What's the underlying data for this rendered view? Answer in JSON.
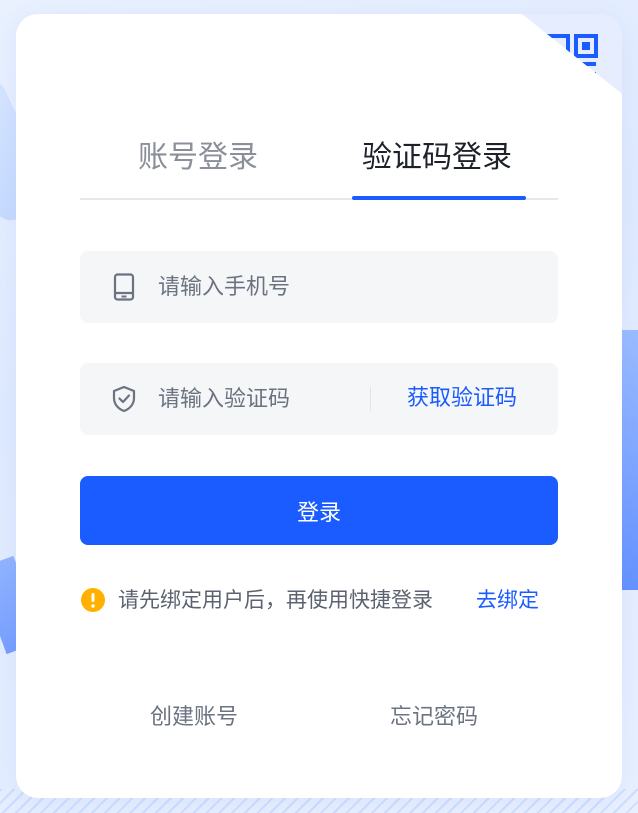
{
  "tabs": [
    {
      "label": "账号登录",
      "active": false
    },
    {
      "label": "验证码登录",
      "active": true
    }
  ],
  "phone_field": {
    "placeholder": "请输入手机号",
    "value": "",
    "icon": "mobile-phone-icon"
  },
  "code_field": {
    "placeholder": "请输入验证码",
    "value": "",
    "icon": "shield-check-icon",
    "get_code_label": "获取验证码"
  },
  "login_button": {
    "label": "登录"
  },
  "notice": {
    "text": "请先绑定用户后，再使用快捷登录",
    "link_label": "去绑定",
    "icon": "warning-icon"
  },
  "footer": {
    "create_account": "创建账号",
    "forgot_password": "忘记密码"
  },
  "colors": {
    "accent": "#1a5cff",
    "warning": "#ffb000",
    "field_bg": "#f5f6f8",
    "muted_text": "#8a8f99"
  }
}
